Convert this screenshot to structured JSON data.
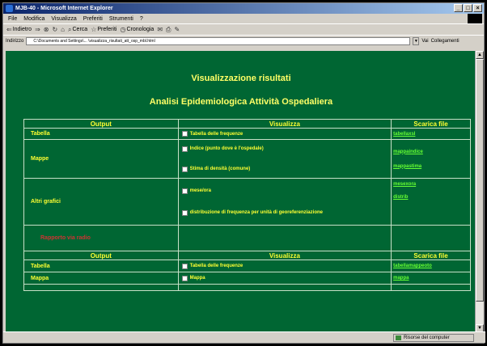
{
  "window": {
    "title": "MJB-40 - Microsoft Internet Explorer",
    "controls": [
      "_",
      "□",
      "×"
    ]
  },
  "menu": [
    "File",
    "Modifica",
    "Visualizza",
    "Preferiti",
    "Strumenti",
    "?"
  ],
  "toolbar": {
    "back": "Indietro",
    "search": "Cerca",
    "favorites": "Preferiti",
    "media": "Cronologia"
  },
  "address": {
    "label": "Indirizzo",
    "value": "C:\\Documents and Settings\\... \\visualizza_risultati_att_osp_mbl.html",
    "go": "Vai",
    "links": "Collegamenti"
  },
  "page": {
    "title": "Visualizzazione risultati",
    "subtitle": "Analisi Epidemiologica Attività Ospedaliera"
  },
  "table": {
    "headers": [
      "Output",
      "Visualizza",
      "Scarica file"
    ],
    "rows": {
      "tabella": {
        "label": "Tabella",
        "option": "Tabella delle frequenze",
        "download": "tabellaxsl"
      },
      "mappe": {
        "label": "Mappe",
        "options": [
          "Indice (punto dove è l'ospedale)",
          "Stima di densità (comune)"
        ],
        "downloads": [
          "mappaindice",
          "mappastima"
        ]
      },
      "altri": {
        "label": "Altri grafici",
        "options": [
          "mese/ora",
          "distribuzione di frequenza per unità di georeferenziazione"
        ],
        "downloads": [
          "mesexora",
          "distrib"
        ]
      },
      "red_link": "Rapporto via radio"
    },
    "headers2": [
      "Output",
      "Visualizza",
      "Scarica file"
    ],
    "rows2": {
      "tabella": {
        "label": "Tabella",
        "option": "Tabella delle frequenze",
        "download": "tabellamappeoto"
      },
      "mappa": {
        "label": "Mappa",
        "option": "Mappa",
        "download": "mappa"
      }
    }
  },
  "status": {
    "left": "",
    "zone": "Risorse del computer"
  }
}
